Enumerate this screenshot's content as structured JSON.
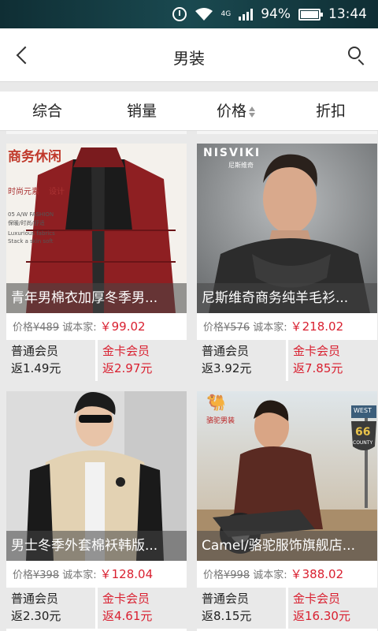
{
  "status": {
    "net_type": "4G",
    "battery": "94%",
    "time": "13:44"
  },
  "header": {
    "title": "男装"
  },
  "tabs": [
    {
      "label": "综合"
    },
    {
      "label": "销量"
    },
    {
      "label": "价格"
    },
    {
      "label": "折扣"
    }
  ],
  "products": [
    {
      "name": "青年男棉衣加厚冬季男...",
      "price_label": "价格",
      "original_price": "¥489",
      "sale_label": "诚本家:",
      "sale_price": "￥99.02",
      "normal_member_label": "普通会员",
      "normal_rebate": "返1.49元",
      "gold_member_label": "金卡会员",
      "gold_rebate": "返2.97元",
      "image_text": [
        "商务休闲",
        "时尚元素",
        "设计",
        "05 A/W FASHION",
        "保暖/时尚/舒适",
        "Luxurious fabrics",
        "Stack a skin soft"
      ]
    },
    {
      "name": "尼斯维奇商务纯羊毛衫...",
      "price_label": "价格",
      "original_price": "¥576",
      "sale_label": "诚本家:",
      "sale_price": "￥218.02",
      "normal_member_label": "普通会员",
      "normal_rebate": "返3.92元",
      "gold_member_label": "金卡会员",
      "gold_rebate": "返7.85元",
      "image_text": [
        "NISVIKI",
        "尼斯维奇"
      ]
    },
    {
      "name": "男士冬季外套棉袄韩版...",
      "price_label": "价格",
      "original_price": "¥398",
      "sale_label": "诚本家:",
      "sale_price": "￥128.04",
      "normal_member_label": "普通会员",
      "normal_rebate": "返2.30元",
      "gold_member_label": "金卡会员",
      "gold_rebate": "返4.61元",
      "image_text": []
    },
    {
      "name": "Camel/骆驼服饰旗舰店...",
      "price_label": "价格",
      "original_price": "¥998",
      "sale_label": "诚本家:",
      "sale_price": "￥388.02",
      "normal_member_label": "普通会员",
      "normal_rebate": "返8.15元",
      "gold_member_label": "金卡会员",
      "gold_rebate": "返16.30元",
      "image_text": [
        "骆驼男装",
        "WEST",
        "66",
        "COUNTY"
      ]
    }
  ],
  "colors": {
    "accent_red": "#d92030",
    "status_bar": "#1a4950"
  }
}
